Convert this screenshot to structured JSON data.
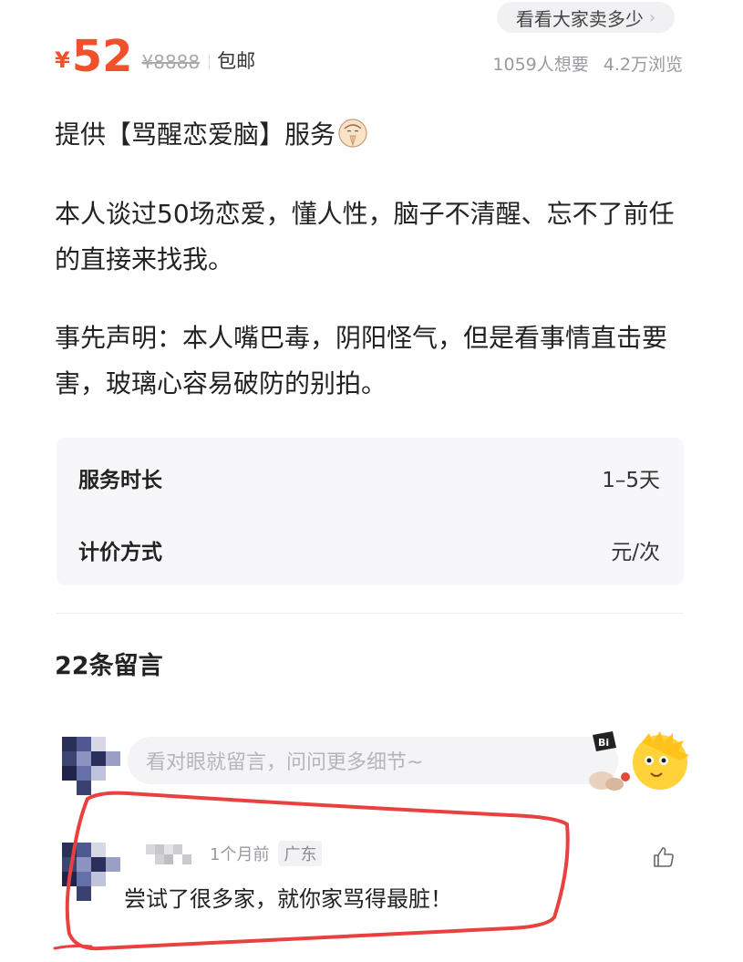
{
  "header": {
    "compare_label": "看看大家卖多少",
    "chevron": "›"
  },
  "price": {
    "currency": "¥",
    "value": "52",
    "original": "¥8888",
    "shipping": "包邮",
    "want_count": "1059人想要",
    "views": "4.2万浏览"
  },
  "listing": {
    "title": "提供【骂醒恋爱脑】服务",
    "title_icon": "folded-hands-face-emoji",
    "paragraph1": "本人谈过50场恋爱，懂人性，脑子不清醒、忘不了前任的直接来找我。",
    "paragraph2": "事先声明：本人嘴巴毒，阴阳怪气，但是看事情直击要害，玻璃心容易破防的别拍。"
  },
  "info": {
    "rows": [
      {
        "key": "服务时长",
        "value": "1–5天"
      },
      {
        "key": "计价方式",
        "value": "元/次"
      }
    ]
  },
  "comments": {
    "heading": "22条留言",
    "input_placeholder": "看对眼就留言，问问更多细节~",
    "items": [
      {
        "time": "1个月前",
        "region": "广东",
        "text": "尝试了很多家，就你家骂得最脏！"
      }
    ]
  },
  "colors": {
    "accent": "#f0502a",
    "highlight": "#e8413f",
    "card_bg": "#f7f7f9"
  }
}
